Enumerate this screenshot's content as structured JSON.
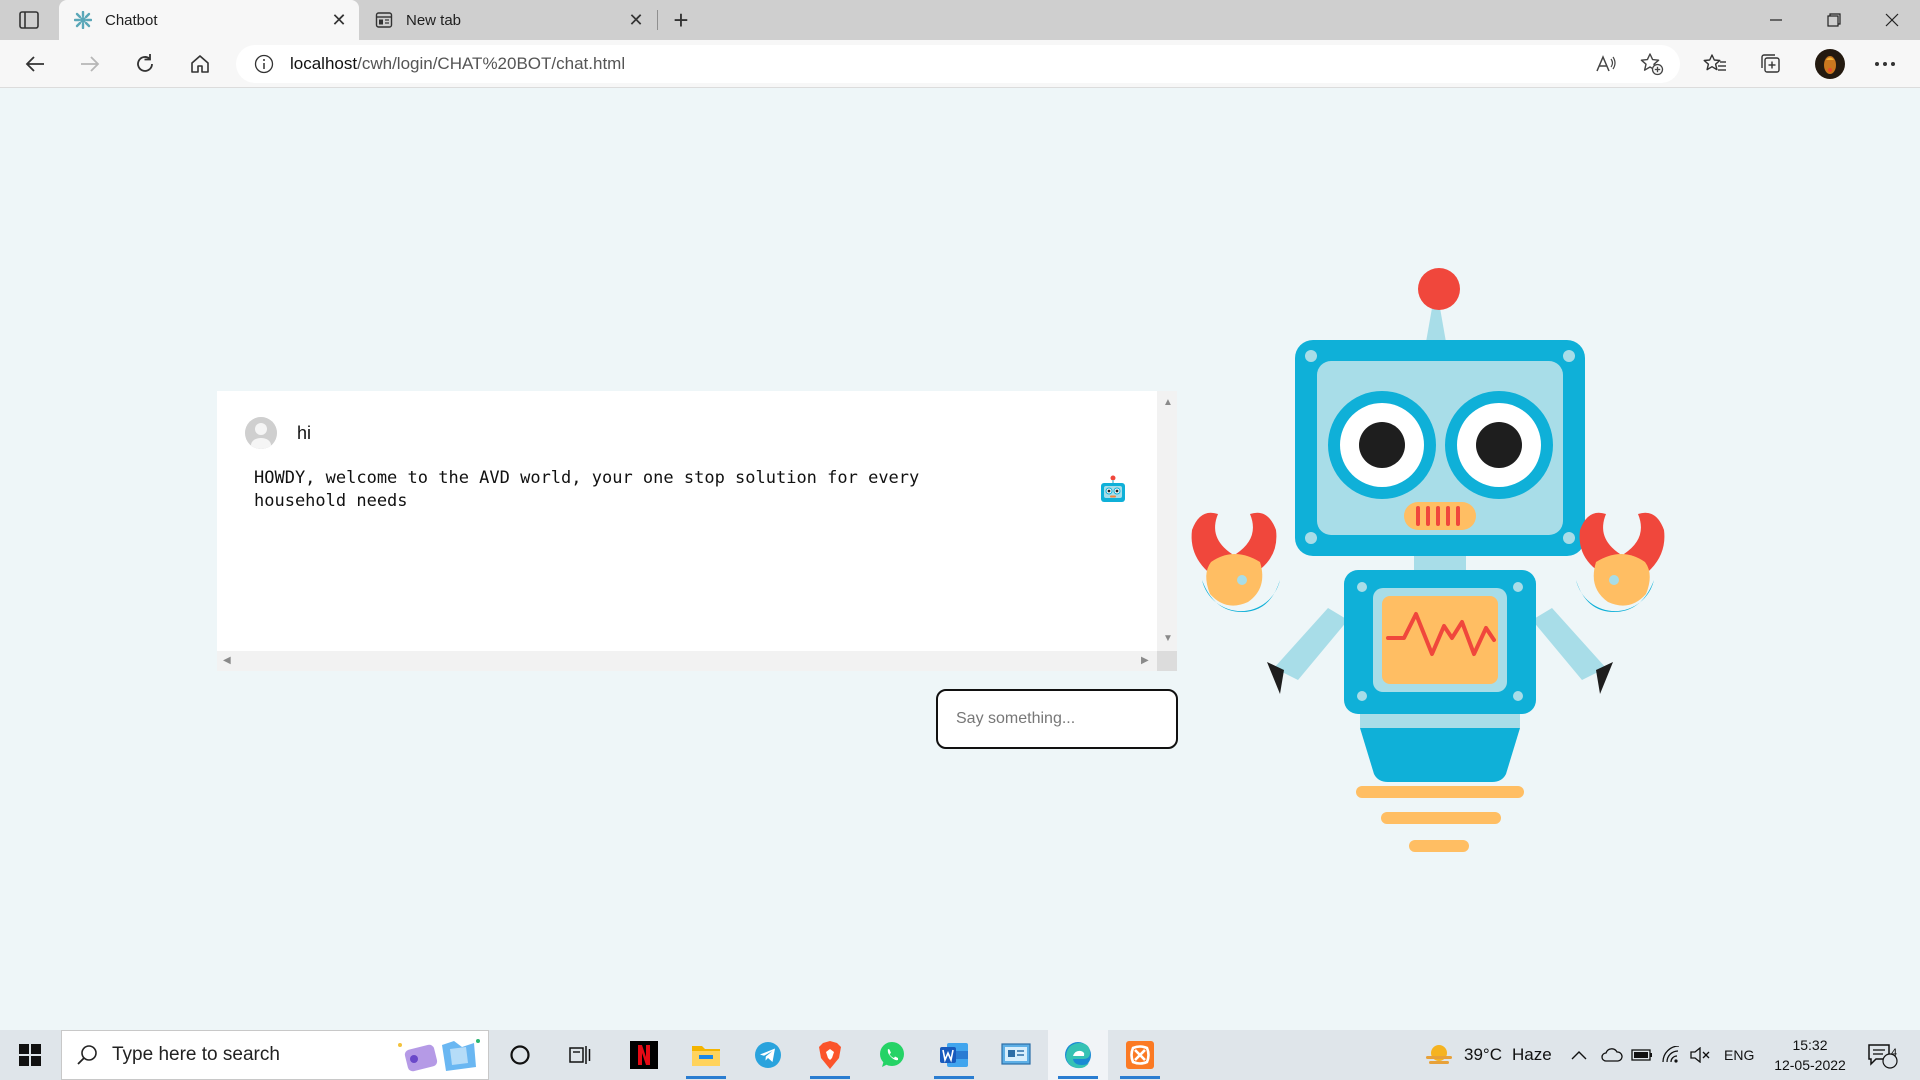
{
  "browser": {
    "tabs": [
      {
        "title": "Chatbot",
        "active": true
      },
      {
        "title": "New tab",
        "active": false
      }
    ],
    "address": {
      "host": "localhost",
      "path": "/cwh/login/CHAT%20BOT/chat.html"
    }
  },
  "chat": {
    "user_message": "hi",
    "bot_message": "HOWDY, welcome to the AVD world, your one stop solution for every household needs"
  },
  "input": {
    "placeholder": "Say something..."
  },
  "taskbar": {
    "search_placeholder": "Type here to search",
    "weather_temp": "39°C",
    "weather_desc": "Haze",
    "language": "ENG",
    "time": "15:32",
    "date": "12-05-2022",
    "notification_count": "4"
  },
  "colors": {
    "page_bg": "#eef6f8",
    "robot_blue": "#0fb0d8",
    "robot_light": "#a8dde8",
    "robot_red": "#f0473c",
    "robot_orange": "#ffbe63"
  }
}
